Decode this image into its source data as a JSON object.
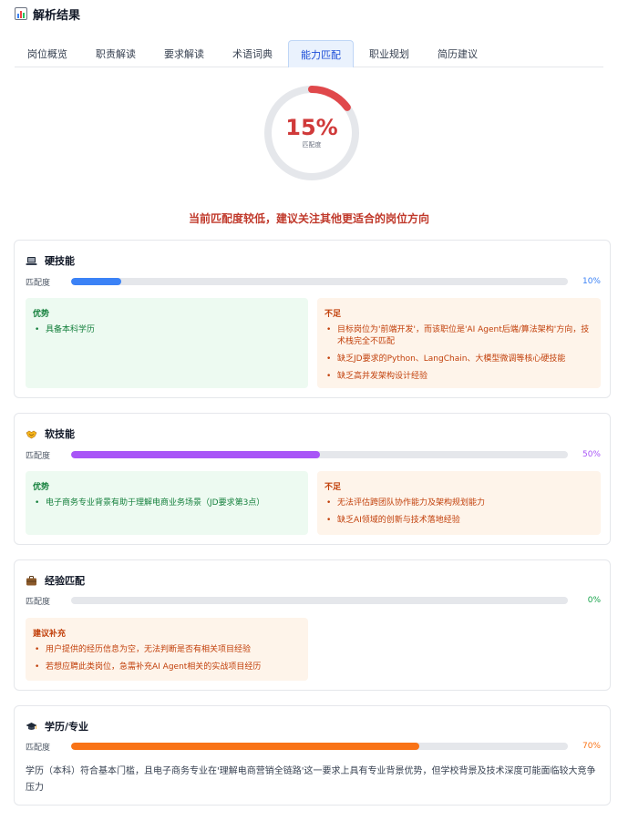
{
  "header": {
    "title": "解析结果",
    "icon": "bar-chart-icon"
  },
  "tabs": [
    {
      "label": "岗位概览",
      "active": false
    },
    {
      "label": "职责解读",
      "active": false
    },
    {
      "label": "要求解读",
      "active": false
    },
    {
      "label": "术语词典",
      "active": false
    },
    {
      "label": "能力匹配",
      "active": true
    },
    {
      "label": "职业规划",
      "active": false
    },
    {
      "label": "简历建议",
      "active": false
    }
  ],
  "overall": {
    "percent_text": "15%",
    "value": 15,
    "label": "匹配度",
    "color": "#e0484b"
  },
  "warning": "当前匹配度较低，建议关注其他更适合的岗位方向",
  "sections": {
    "hard": {
      "icon": "laptop-icon",
      "title": "硬技能",
      "bar_label": "匹配度",
      "value": 10,
      "percent_text": "10%",
      "color": "#3b82f6",
      "adv_title": "优势",
      "adv_items": [
        "具备本科学历"
      ],
      "gap_title": "不足",
      "gap_items": [
        "目标岗位为'前端开发'，而该职位是'AI Agent后端/算法架构'方向，技术栈完全不匹配",
        "缺乏JD要求的Python、LangChain、大模型微调等核心硬技能",
        "缺乏高并发架构设计经验"
      ]
    },
    "soft": {
      "icon": "handshake-icon",
      "title": "软技能",
      "bar_label": "匹配度",
      "value": 50,
      "percent_text": "50%",
      "color": "#a855f7",
      "adv_title": "优势",
      "adv_items": [
        "电子商务专业背景有助于理解电商业务场景（JD要求第3点）"
      ],
      "gap_title": "不足",
      "gap_items": [
        "无法评估跨团队协作能力及架构规划能力",
        "缺乏AI领域的创新与技术落地经验"
      ]
    },
    "exp": {
      "icon": "briefcase-icon",
      "title": "经验匹配",
      "bar_label": "匹配度",
      "value": 0,
      "percent_text": "0%",
      "color": "#16a34a",
      "suggest_title": "建议补充",
      "suggest_items": [
        "用户提供的经历信息为空，无法判断是否有相关项目经验",
        "若想应聘此类岗位，急需补充AI Agent相关的实战项目经历"
      ]
    },
    "edu": {
      "icon": "graduation-cap-icon",
      "title": "学历/专业",
      "bar_label": "匹配度",
      "value": 70,
      "percent_text": "70%",
      "color": "#f97316",
      "text": "学历（本科）符合基本门槛，且电子商务专业在'理解电商营销全链路'这一要求上具有专业背景优势，但学校背景及技术深度可能面临较大竞争压力"
    }
  }
}
